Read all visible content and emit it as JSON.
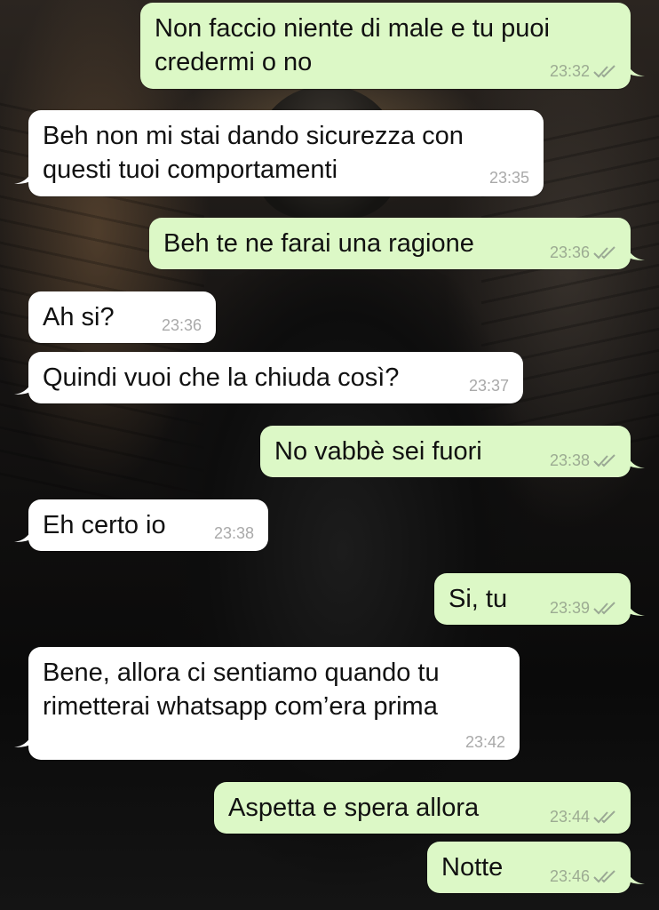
{
  "messages": [
    {
      "side": "out",
      "text": "Non faccio niente di male e tu puoi\ncredermi o no",
      "time": "23:32",
      "read": true
    },
    {
      "side": "in",
      "text": "Beh non mi stai dando sicurezza con\nquesti tuoi comportamenti",
      "time": "23:35"
    },
    {
      "side": "out",
      "text": "Beh te ne farai una ragione",
      "time": "23:36",
      "read": true
    },
    {
      "side": "in",
      "text": "Ah si?",
      "time": "23:36"
    },
    {
      "side": "in",
      "text": "Quindi vuoi che la chiuda così?",
      "time": "23:37"
    },
    {
      "side": "out",
      "text": "No vabbè sei fuori",
      "time": "23:38",
      "read": true
    },
    {
      "side": "in",
      "text": "Eh certo io",
      "time": "23:38"
    },
    {
      "side": "out",
      "text": "Si, tu",
      "time": "23:39",
      "read": true
    },
    {
      "side": "in",
      "text": "Bene, allora ci sentiamo quando tu\nrimetterai whatsapp com’era prima",
      "time": "23:42"
    },
    {
      "side": "out",
      "text": "Aspetta e spera allora",
      "time": "23:44",
      "read": true
    },
    {
      "side": "out",
      "text": "Notte",
      "time": "23:46",
      "read": true
    }
  ],
  "icons": {
    "read_receipt": "double-check-icon"
  },
  "colors": {
    "incoming_bubble": "#ffffff",
    "outgoing_bubble": "#dcf8c6",
    "timestamp": "#a9a9a9"
  }
}
